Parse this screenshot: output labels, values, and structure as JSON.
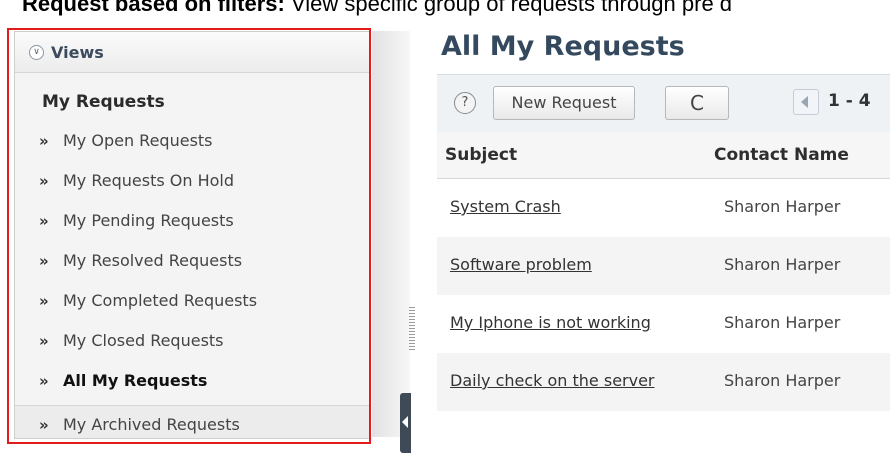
{
  "caption": {
    "bold": "Request based on filters:",
    "rest": " View specific group of requests through pre d"
  },
  "sidebar": {
    "title": "Views",
    "group_title": "My Requests",
    "items": [
      {
        "label": "My Open Requests",
        "active": false
      },
      {
        "label": "My Requests On Hold",
        "active": false
      },
      {
        "label": "My Pending Requests",
        "active": false
      },
      {
        "label": "My Resolved Requests",
        "active": false
      },
      {
        "label": "My Completed Requests",
        "active": false
      },
      {
        "label": "My Closed Requests",
        "active": false
      },
      {
        "label": "All My Requests",
        "active": true
      },
      {
        "label": "My Archived Requests",
        "active": false
      }
    ],
    "bullet": "»"
  },
  "main": {
    "title": "All My Requests",
    "toolbar": {
      "help_label": "?",
      "new_request_label": "New Request",
      "refresh_symbol": "C",
      "range": "1 - 4"
    },
    "table": {
      "columns": [
        "Subject",
        "Contact Name"
      ],
      "rows": [
        {
          "subject": "System Crash",
          "contact": "Sharon Harper"
        },
        {
          "subject": "Software problem",
          "contact": "Sharon Harper"
        },
        {
          "subject": "My Iphone is not working",
          "contact": "Sharon Harper"
        },
        {
          "subject": "Daily check on the server",
          "contact": "Sharon Harper"
        }
      ]
    }
  },
  "colors": {
    "highlight": "#e31b1b",
    "title": "#34495e"
  }
}
